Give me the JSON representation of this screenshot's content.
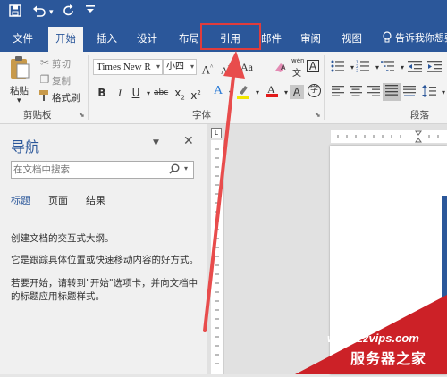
{
  "quick_access": {
    "save_icon": "save-icon",
    "undo_icon": "undo-icon",
    "redo_icon": "redo-icon",
    "customize_icon": "customize-icon"
  },
  "tabs": [
    "文件",
    "开始",
    "插入",
    "设计",
    "布局",
    "引用",
    "邮件",
    "审阅",
    "视图"
  ],
  "tell_me": "告诉我你想要",
  "clipboard": {
    "paste": "粘贴",
    "cut": "剪切",
    "copy": "复制",
    "format_painter": "格式刷",
    "group_label": "剪贴板"
  },
  "font": {
    "name": "Times New R",
    "size": "小四",
    "group_label": "字体",
    "wen_top": "wén",
    "wen_bottom": "文"
  },
  "paragraph": {
    "group_label": "段落"
  },
  "nav_pane": {
    "title": "导航",
    "search_placeholder": "在文档中搜索",
    "tabs": [
      "标题",
      "页面",
      "结果"
    ],
    "lines": [
      "创建文档的交互式大纲。",
      "它是跟踪具体位置或快速移动内容的好方式。",
      "若要开始，请转到\"开始\"选项卡，并向文档中的标题应用标题样式。"
    ]
  },
  "watermark": {
    "url": "www.zzvips.com",
    "name": "服务器之家"
  },
  "colors": {
    "accent": "#2b579a",
    "highlight": "#e03c3c",
    "arrow": "#e84c4c",
    "ribbon_bg": "#f3f3f3"
  }
}
